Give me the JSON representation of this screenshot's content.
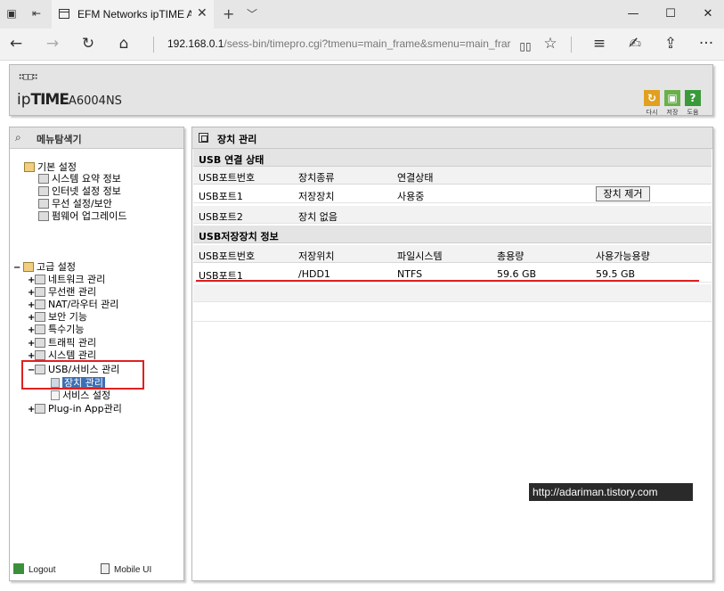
{
  "browser": {
    "tab_title": "EFM Networks ipTIME A",
    "tab_close": "✕",
    "new_tab": "+",
    "tab_list": "﹀",
    "address_host": "192.168.0.1",
    "address_path": "/sess-bin/timepro.cgi?tmenu=main_frame&smenu=main_frar",
    "back": "←",
    "forward": "→",
    "refresh": "↻",
    "home": "⌂",
    "minimize": "—",
    "maximize": "☐",
    "close": "✕",
    "reading_view": "▯▯",
    "favorite": "☆",
    "hub": "≡",
    "notes": "✍",
    "share": "⇪",
    "more": "···"
  },
  "router": {
    "logo_mark": "∷□□∷",
    "brand_ip": "ip",
    "brand_time": "TIME",
    "brand_model": "A6004NS",
    "buttons": [
      {
        "label": "다시",
        "color": "#e0a020"
      },
      {
        "label": "저장",
        "color": "#6ab04a"
      },
      {
        "label": "도움",
        "color": "#3a9a3a"
      }
    ]
  },
  "menu": {
    "title": "메뉴탐색기",
    "basic_setup": "기본 설정",
    "basic_items": [
      "시스템 요약 정보",
      "인터넷 설정 정보",
      "무선 설정/보안",
      "펌웨어 업그레이드"
    ],
    "advanced_setup": "고급 설정",
    "advanced_items": [
      "네트워크 관리",
      "무선랜 관리",
      "NAT/라우터 관리",
      "보안 기능",
      "특수기능",
      "트래픽 관리",
      "시스템 관리",
      "USB/서비스 관리"
    ],
    "usb_children": [
      "장치 관리",
      "서비스 설정"
    ],
    "plugin": "Plug-in App관리",
    "expand_plus": "+",
    "expand_minus": "−",
    "logout": "Logout",
    "mobile_ui": "Mobile UI"
  },
  "content": {
    "title": "장치 관리",
    "usb_connection": {
      "heading": "USB 연결 상태",
      "columns": [
        "USB포트번호",
        "장치종류",
        "연결상태"
      ],
      "rows": [
        [
          "USB포트1",
          "저장장치",
          "사용중"
        ],
        [
          "USB포트2",
          "장치 없음",
          ""
        ]
      ],
      "eject_button": "장치 제거"
    },
    "usb_storage": {
      "heading": "USB저장장치 정보",
      "columns": [
        "USB포트번호",
        "저장위치",
        "파일시스템",
        "총용량",
        "사용가능용량"
      ],
      "rows": [
        [
          "USB포트1",
          "/HDD1",
          "NTFS",
          "59.6 GB",
          "59.5 GB"
        ]
      ]
    }
  },
  "watermark": "http://adariman.tistory.com"
}
